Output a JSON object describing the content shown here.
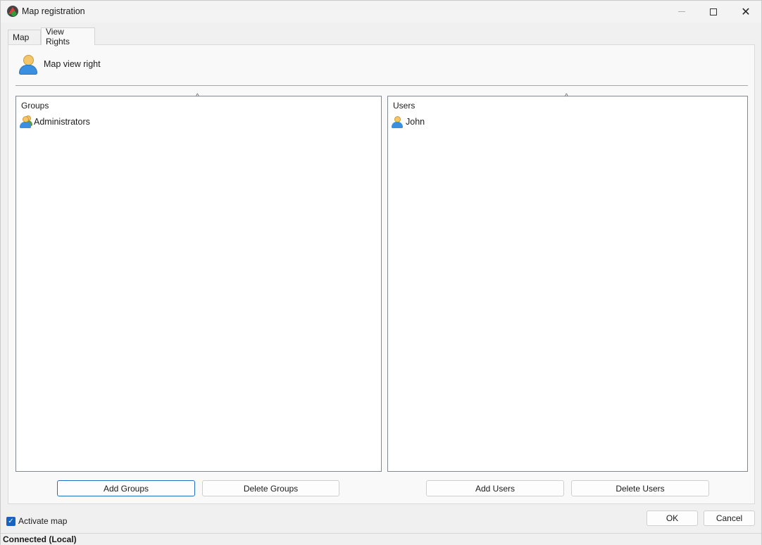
{
  "window": {
    "title": "Map registration"
  },
  "tabs": [
    {
      "label": "Map",
      "active": false
    },
    {
      "label": "View Rights",
      "active": true
    }
  ],
  "header": {
    "label": "Map view right",
    "icon": "user-icon"
  },
  "groups": {
    "column_header": "Groups",
    "items": [
      {
        "label": "Administrators",
        "icon": "group-icon"
      }
    ],
    "add_button": "Add Groups",
    "delete_button": "Delete Groups"
  },
  "users": {
    "column_header": "Users",
    "items": [
      {
        "label": "John",
        "icon": "user-icon"
      }
    ],
    "add_button": "Add Users",
    "delete_button": "Delete Users"
  },
  "footer": {
    "activate_map_label": "Activate map",
    "activate_map_checked": true,
    "ok_label": "OK",
    "cancel_label": "Cancel"
  },
  "status": {
    "text": "Connected (Local)"
  },
  "colors": {
    "accent": "#1464c4",
    "checkbox": "#1464c4"
  }
}
